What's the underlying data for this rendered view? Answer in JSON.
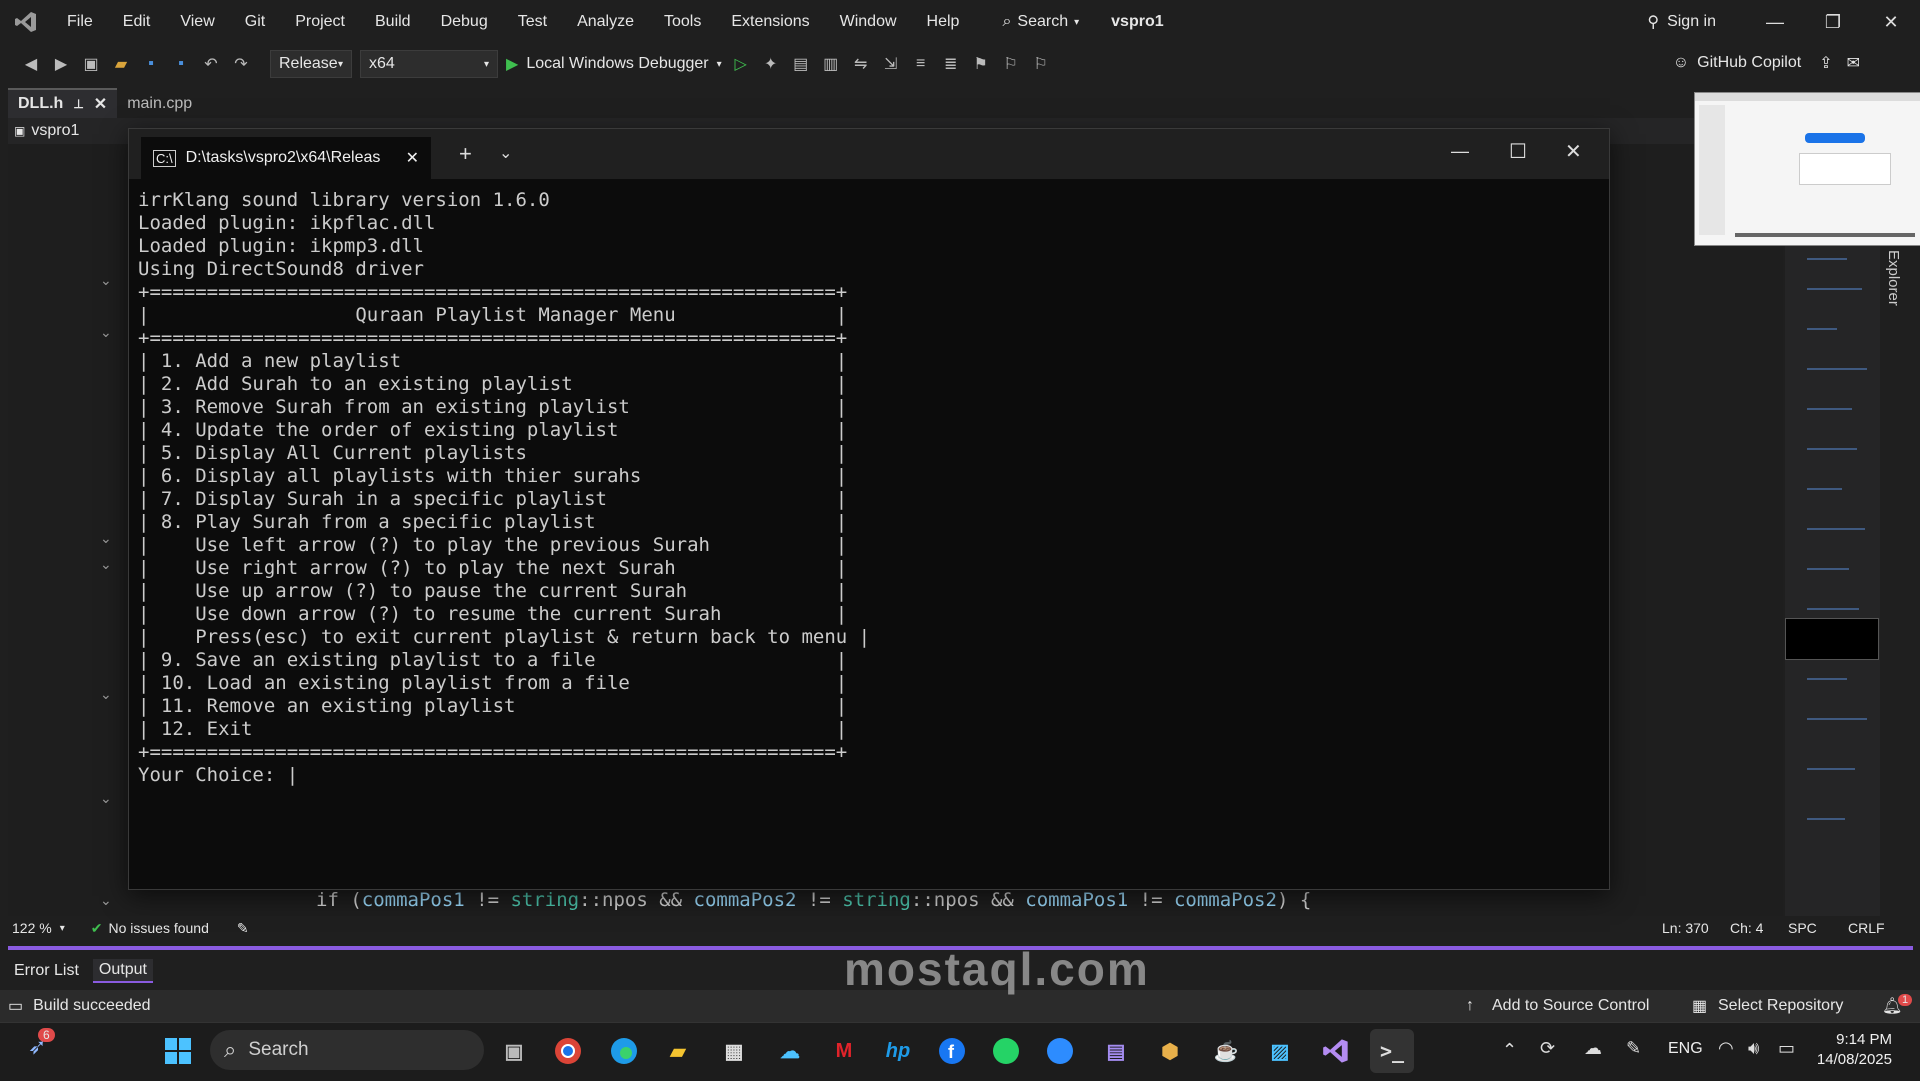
{
  "menu": {
    "items": [
      "File",
      "Edit",
      "View",
      "Git",
      "Project",
      "Build",
      "Debug",
      "Test",
      "Analyze",
      "Tools",
      "Extensions",
      "Window",
      "Help"
    ],
    "search_label": "Search",
    "solution_name": "vspro1",
    "sign_in": "Sign in"
  },
  "toolbar": {
    "configuration": "Release",
    "platform": "x64",
    "debugger": "Local Windows Debugger",
    "copilot": "GitHub Copilot"
  },
  "tabs": [
    {
      "label": "DLL.h",
      "active": true
    },
    {
      "label": "main.cpp",
      "active": false
    }
  ],
  "nav": {
    "project": "vspro1"
  },
  "terminal": {
    "tab_title": "D:\\tasks\\vspro2\\x64\\Releas",
    "lines": [
      "irrKlang sound library version 1.6.0",
      "Loaded plugin: ikpflac.dll",
      "Loaded plugin: ikpmp3.dll",
      "Using DirectSound8 driver",
      "+============================================================+",
      "|                  Quraan Playlist Manager Menu              |",
      "+============================================================+",
      "| 1. Add a new playlist                                      |",
      "| 2. Add Surah to an existing playlist                       |",
      "| 3. Remove Surah from an existing playlist                  |",
      "| 4. Update the order of existing playlist                   |",
      "| 5. Display All Current playlists                           |",
      "| 6. Display all playlists with thier surahs                 |",
      "| 7. Display Surah in a specific playlist                    |",
      "| 8. Play Surah from a specific playlist                     |",
      "|    Use left arrow (?) to play the previous Surah           |",
      "|    Use right arrow (?) to play the next Surah              |",
      "|    Use up arrow (?) to pause the current Surah             |",
      "|    Use down arrow (?) to resume the current Surah          |",
      "|    Press(esc) to exit current playlist & return back to menu |",
      "| 9. Save an existing playlist to a file                     |",
      "| 10. Load an existing playlist from a file                  |",
      "| 11. Remove an existing playlist                            |",
      "| 12. Exit                                                   |",
      "+============================================================+",
      "Your Choice: |"
    ]
  },
  "code": {
    "line_parts": [
      "if (",
      "commaPos1",
      " != ",
      "string",
      "::npos && ",
      "commaPos2",
      " != ",
      "string",
      "::npos && ",
      "commaPos1",
      " != ",
      "commaPos2",
      ") {"
    ]
  },
  "editor_status": {
    "zoom": "122 %",
    "issues": "No issues found",
    "line": "Ln: 370",
    "col": "Ch: 4",
    "spc": "SPC",
    "crlf": "CRLF"
  },
  "side_panel": {
    "explorer": "Explorer"
  },
  "panel_tabs": [
    "Error List",
    "Output"
  ],
  "status": {
    "build": "Build succeeded",
    "source_control": "Add to Source Control",
    "repository": "Select Repository",
    "notification_count": "1"
  },
  "taskbar": {
    "search": "Search",
    "copilot_badge": "6",
    "lang": "ENG",
    "time": "9:14 PM",
    "date": "14/08/2025"
  },
  "watermark": "mostaql.com"
}
